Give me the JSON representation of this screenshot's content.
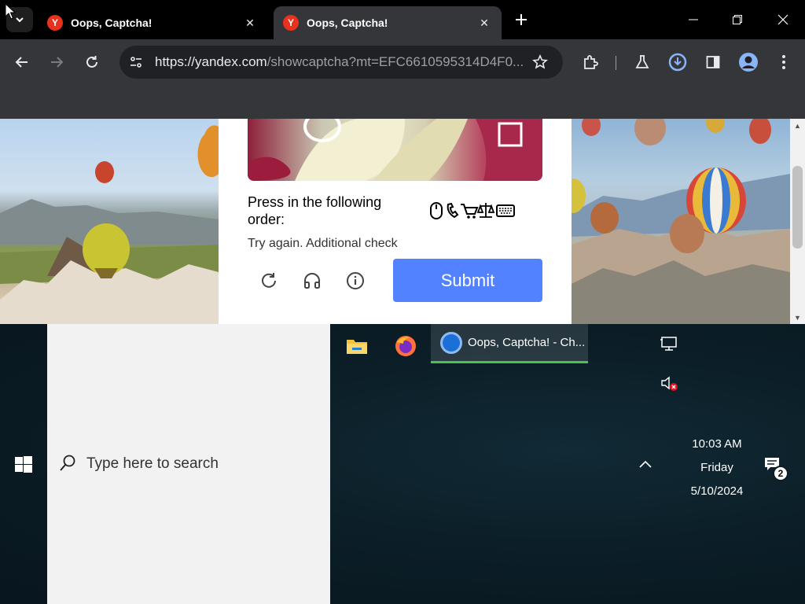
{
  "browser": {
    "tab_search_icon": "chevron-down-icon",
    "tabs": [
      {
        "title": "Oops, Captcha!",
        "favicon": "Y",
        "active": false
      },
      {
        "title": "Oops, Captcha!",
        "favicon": "Y",
        "active": true
      }
    ],
    "url_host": "https://yandex.com",
    "url_path": "/showcaptcha?mt=EFC6610595314D4F0..."
  },
  "captcha": {
    "instruction": "Press in the following order:",
    "order_icons": [
      "mouse-icon",
      "phone-icon",
      "cart-icon",
      "scales-icon",
      "keyboard-icon"
    ],
    "retry_text": "Try again. Additional check",
    "submit_label": "Submit"
  },
  "taskbar": {
    "search_placeholder": "Type here to search",
    "chrome_task_label": "Oops, Captcha! - Ch...",
    "clock_time": "10:03 AM",
    "clock_day": "Friday",
    "clock_date": "5/10/2024",
    "notification_count": "2"
  },
  "colors": {
    "submit": "#5282ff",
    "active_task_underline": "#4cc24c",
    "favicon": "#e8321e"
  }
}
